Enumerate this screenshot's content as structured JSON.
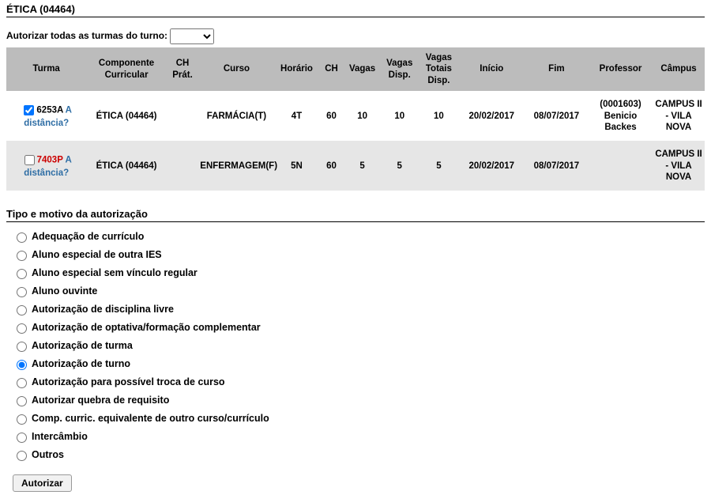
{
  "pageTitle": "ÉTICA (04464)",
  "bulkLabel": "Autorizar todas as turmas do turno:",
  "table": {
    "headers": {
      "turma": "Turma",
      "componente": "Componente Curricular",
      "chprat": "CH Prát.",
      "curso": "Curso",
      "horario": "Horário",
      "ch": "CH",
      "vagas": "Vagas",
      "vagasDisp": "Vagas Disp.",
      "vagasTotaisDisp": "Vagas Totais Disp.",
      "inicio": "Início",
      "fim": "Fim",
      "professor": "Professor",
      "campus": "Câmpus"
    },
    "rows": [
      {
        "checked": true,
        "code": "6253A",
        "codeRed": false,
        "distancia": "A distância?",
        "componente": "ÉTICA (04464)",
        "chprat": "",
        "curso": "FARMÁCIA(T)",
        "horario": "4T",
        "ch": "60",
        "vagas": "10",
        "vagasDisp": "10",
        "vagasTotaisDisp": "10",
        "inicio": "20/02/2017",
        "fim": "08/07/2017",
        "professor": "(0001603) Benicio Backes",
        "campus": "CAMPUS II - VILA NOVA"
      },
      {
        "checked": false,
        "code": "7403P",
        "codeRed": true,
        "distancia": "A distância?",
        "componente": "ÉTICA (04464)",
        "chprat": "",
        "curso": "ENFERMAGEM(F)",
        "horario": "5N",
        "ch": "60",
        "vagas": "5",
        "vagasDisp": "5",
        "vagasTotaisDisp": "5",
        "inicio": "20/02/2017",
        "fim": "08/07/2017",
        "professor": "",
        "campus": "CAMPUS II - VILA NOVA"
      }
    ]
  },
  "sectionTitle": "Tipo e motivo da autorização",
  "reasons": [
    {
      "label": "Adequação de currículo",
      "selected": false
    },
    {
      "label": "Aluno especial de outra IES",
      "selected": false
    },
    {
      "label": "Aluno especial sem vínculo regular",
      "selected": false
    },
    {
      "label": "Aluno ouvinte",
      "selected": false
    },
    {
      "label": "Autorização de disciplina livre",
      "selected": false
    },
    {
      "label": "Autorização de optativa/formação complementar",
      "selected": false
    },
    {
      "label": "Autorização de turma",
      "selected": false
    },
    {
      "label": "Autorização de turno",
      "selected": true
    },
    {
      "label": "Autorização para possível troca de curso",
      "selected": false
    },
    {
      "label": "Autorizar quebra de requisito",
      "selected": false
    },
    {
      "label": "Comp. curric. equivalente de outro curso/currículo",
      "selected": false
    },
    {
      "label": "Intercâmbio",
      "selected": false
    },
    {
      "label": "Outros",
      "selected": false
    }
  ],
  "actions": {
    "authorize": "Autorizar"
  }
}
